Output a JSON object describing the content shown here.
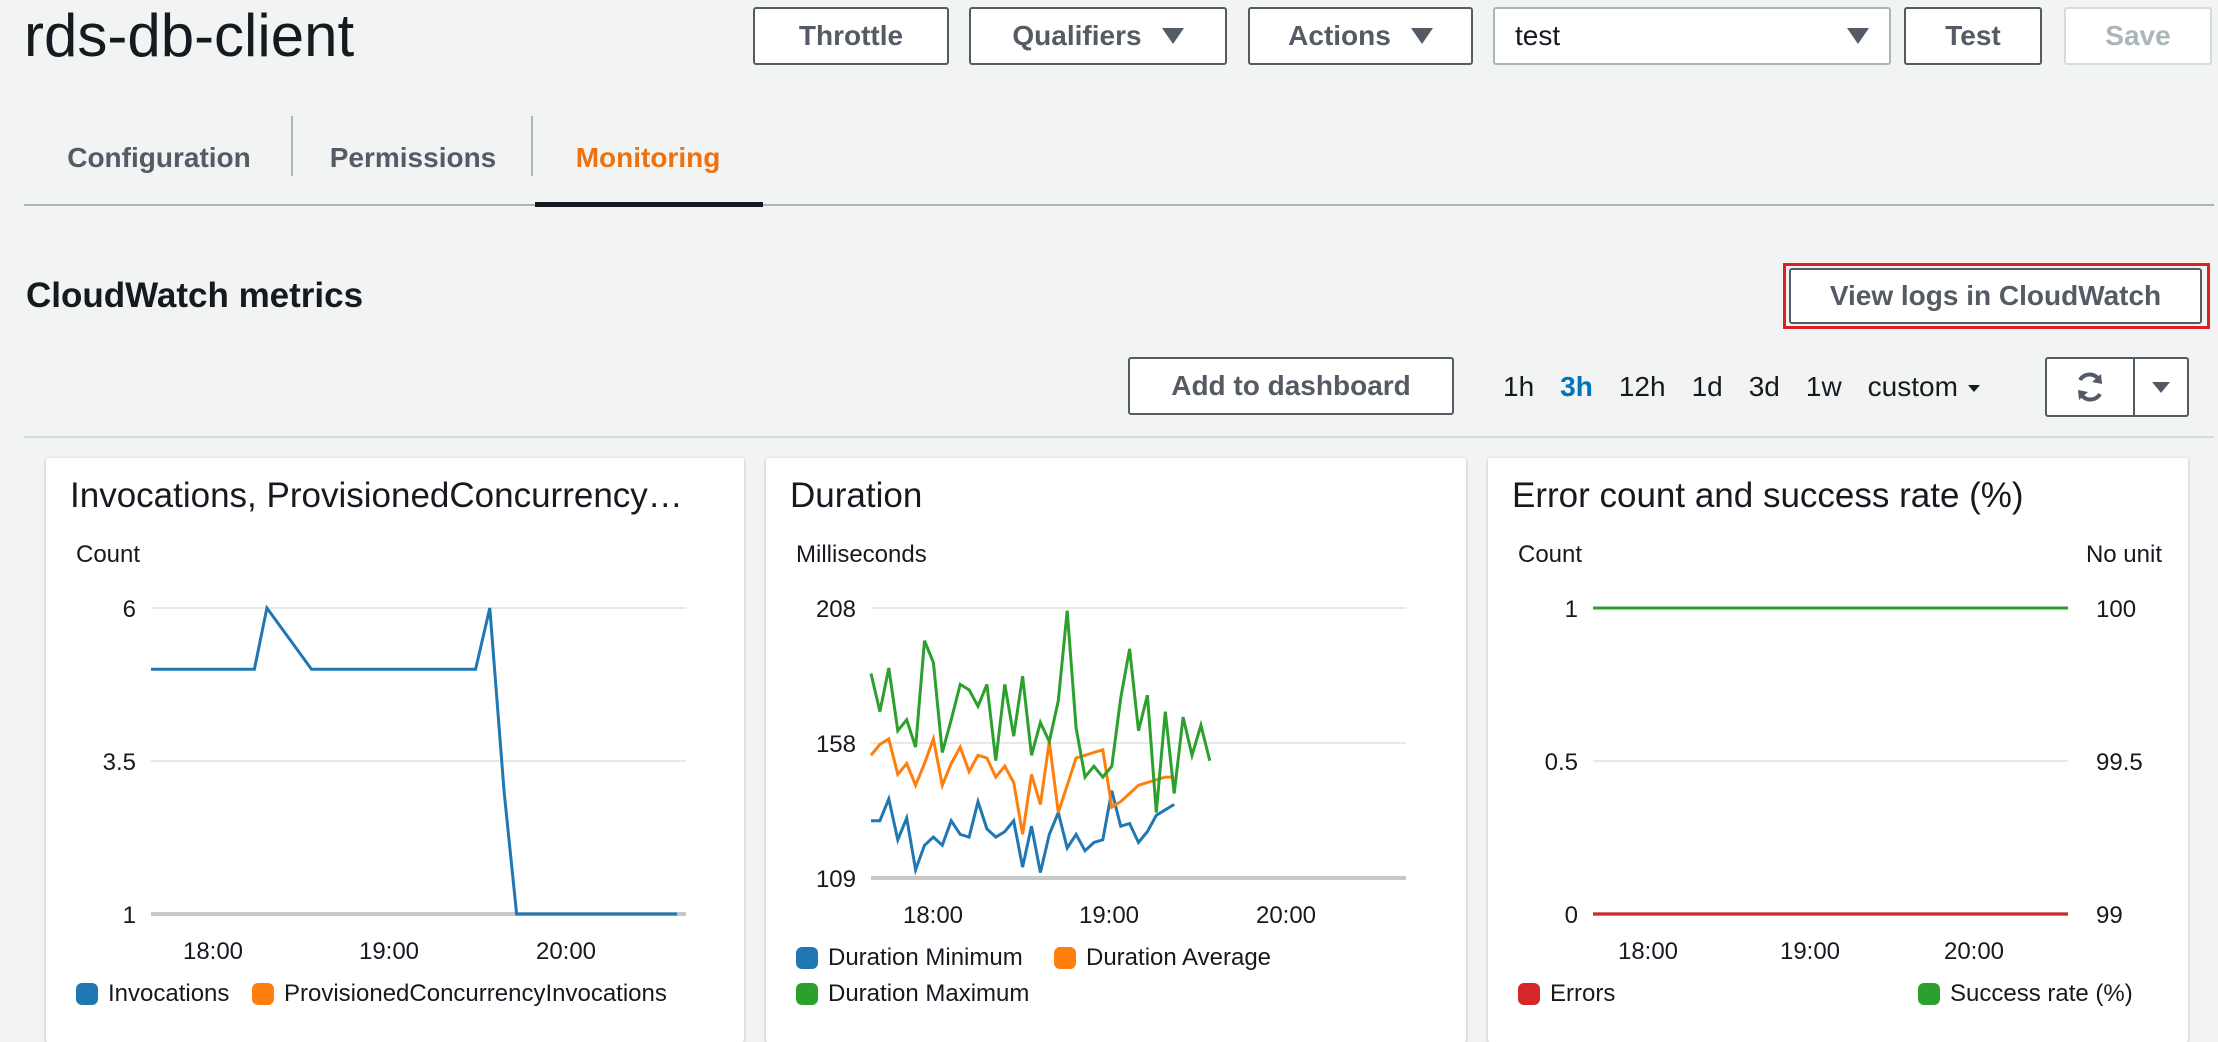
{
  "header": {
    "title": "rds-db-client",
    "buttons": {
      "throttle": "Throttle",
      "qualifiers": "Qualifiers",
      "actions": "Actions",
      "test": "Test",
      "save": "Save"
    },
    "test_event_select": "test"
  },
  "tabs": [
    {
      "label": "Configuration",
      "active": false
    },
    {
      "label": "Permissions",
      "active": false
    },
    {
      "label": "Monitoring",
      "active": true
    }
  ],
  "section": {
    "title": "CloudWatch metrics",
    "view_logs": "View logs in CloudWatch",
    "add_to_dashboard": "Add to dashboard",
    "time_ranges": [
      "1h",
      "3h",
      "12h",
      "1d",
      "3d",
      "1w"
    ],
    "active_range": "3h",
    "custom_label": "custom"
  },
  "colors": {
    "blue": "#1f77b4",
    "orange": "#ff7f0e",
    "green": "#2ca02c",
    "red": "#d62728",
    "accent": "#ec7211",
    "link": "#0073bb"
  },
  "chart_data": [
    {
      "type": "line",
      "title": "Invocations, ProvisionedConcurrency…",
      "ylabel": "Count",
      "y_ticks": [
        "6",
        "3.5",
        "1"
      ],
      "x_ticks": [
        "18:00",
        "19:00",
        "20:00"
      ],
      "ylim": [
        1,
        6
      ],
      "xlim_hours": [
        17.7,
        20.7
      ],
      "series": [
        {
          "name": "Invocations",
          "color": "#1f77b4",
          "x": [
            17.7,
            18.2,
            18.28,
            18.35,
            18.6,
            18.9,
            19.2,
            19.45,
            19.52,
            19.6,
            19.68,
            19.75,
            20.0,
            20.3,
            20.65
          ],
          "values": [
            5,
            5,
            5,
            6,
            5,
            5,
            5,
            5,
            5,
            6,
            3,
            1,
            1,
            1,
            1
          ]
        },
        {
          "name": "ProvisionedConcurrencyInvocations",
          "color": "#ff7f0e",
          "x": [],
          "values": []
        }
      ],
      "legend": [
        "Invocations",
        "ProvisionedConcurrencyInvocations"
      ]
    },
    {
      "type": "line",
      "title": "Duration",
      "ylabel": "Milliseconds",
      "y_ticks": [
        "208",
        "158",
        "109"
      ],
      "x_ticks": [
        "18:00",
        "19:00",
        "20:00"
      ],
      "ylim": [
        109,
        208
      ],
      "xlim_hours": [
        17.7,
        20.7
      ],
      "series": [
        {
          "name": "Duration Minimum",
          "color": "#1f77b4",
          "x": [
            17.7,
            17.75,
            17.8,
            17.85,
            17.9,
            17.95,
            18.0,
            18.05,
            18.1,
            18.15,
            18.2,
            18.25,
            18.3,
            18.35,
            18.4,
            18.45,
            18.5,
            18.55,
            18.6,
            18.65,
            18.7,
            18.75,
            18.8,
            18.85,
            18.9,
            18.95,
            19.0,
            19.05,
            19.1,
            19.15,
            19.2,
            19.25,
            19.3,
            19.35,
            19.4
          ],
          "values": [
            130,
            130,
            138,
            123,
            131,
            112,
            121,
            124,
            121,
            130,
            125,
            124,
            137,
            127,
            124,
            126,
            130,
            113,
            128,
            111,
            125,
            133,
            120,
            125,
            119,
            122,
            123,
            141,
            128,
            129,
            122,
            126,
            132,
            134,
            136
          ]
        },
        {
          "name": "Duration Average",
          "color": "#ff7f0e",
          "x": [
            17.7,
            17.75,
            17.8,
            17.85,
            17.9,
            17.95,
            18.0,
            18.05,
            18.1,
            18.15,
            18.2,
            18.25,
            18.3,
            18.35,
            18.4,
            18.45,
            18.5,
            18.55,
            18.6,
            18.65,
            18.7,
            18.75,
            18.8,
            18.85,
            18.9,
            18.95,
            19.0,
            19.05,
            19.1,
            19.15,
            19.2,
            19.25,
            19.3,
            19.35,
            19.4
          ],
          "values": [
            154,
            158,
            160,
            147,
            151,
            143,
            151,
            160,
            143,
            151,
            157,
            148,
            154,
            153,
            146,
            150,
            144,
            125,
            147,
            136,
            159,
            133,
            143,
            153,
            154,
            155,
            156,
            135,
            137,
            140,
            143,
            144,
            145,
            146,
            146
          ]
        },
        {
          "name": "Duration Maximum",
          "color": "#2ca02c",
          "x": [
            17.7,
            17.75,
            17.8,
            17.85,
            17.9,
            17.95,
            18.0,
            18.05,
            18.1,
            18.15,
            18.2,
            18.25,
            18.3,
            18.35,
            18.4,
            18.45,
            18.5,
            18.55,
            18.6,
            18.65,
            18.7,
            18.75,
            18.8,
            18.85,
            18.9,
            18.95,
            19.0,
            19.05,
            19.1,
            19.15,
            19.2,
            19.25,
            19.3,
            19.35,
            19.4,
            19.45,
            19.5,
            19.55,
            19.6
          ],
          "values": [
            184,
            170,
            186,
            163,
            167,
            157,
            196,
            188,
            155,
            167,
            180,
            178,
            172,
            180,
            152,
            180,
            161,
            183,
            154,
            166,
            159,
            174,
            207,
            164,
            146,
            150,
            146,
            150,
            175,
            193,
            163,
            176,
            133,
            170,
            140,
            168,
            154,
            165,
            152
          ]
        }
      ],
      "legend": [
        "Duration Minimum",
        "Duration Average",
        "Duration Maximum"
      ]
    },
    {
      "type": "line",
      "title": "Error count and success rate (%)",
      "ylabel": "Count",
      "y2label": "No unit",
      "y_ticks": [
        "1",
        "0.5",
        "0"
      ],
      "y2_ticks": [
        "100",
        "99.5",
        "99"
      ],
      "x_ticks": [
        "18:00",
        "19:00",
        "20:00"
      ],
      "series": [
        {
          "name": "Errors",
          "color": "#d62728",
          "values": [
            0,
            0
          ]
        },
        {
          "name": "Success rate (%)",
          "color": "#2ca02c",
          "values": [
            100,
            100
          ]
        }
      ],
      "legend": [
        "Errors",
        "Success rate (%)"
      ]
    }
  ]
}
